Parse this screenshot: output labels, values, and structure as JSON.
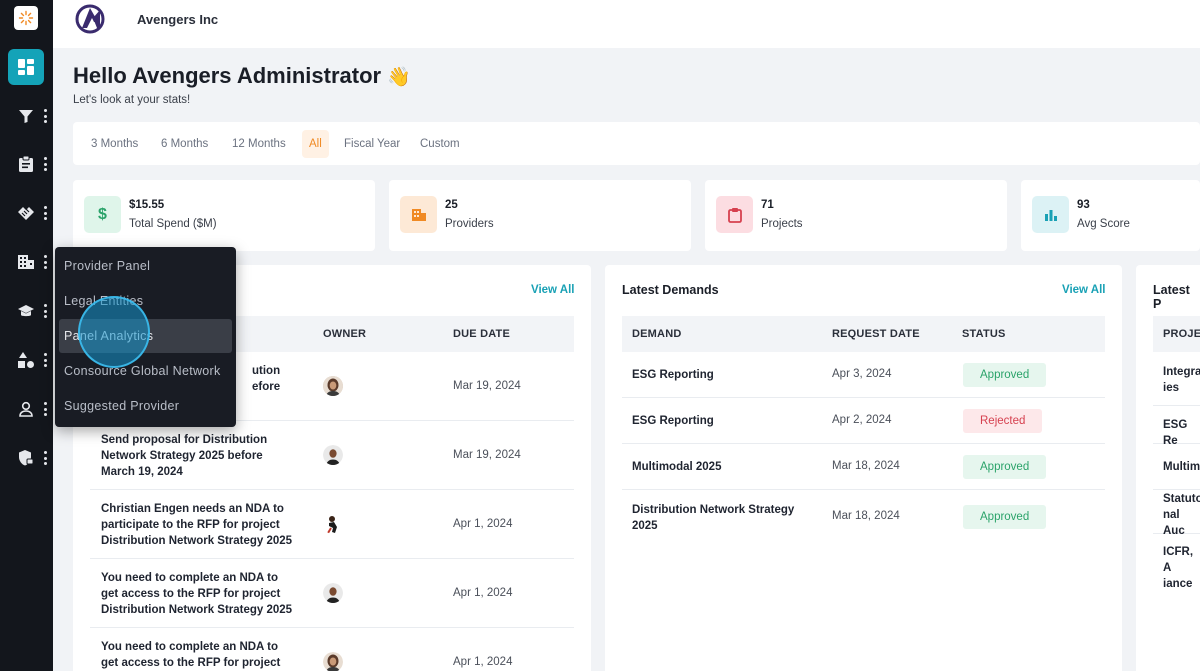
{
  "brand": {
    "name": "Avengers Inc"
  },
  "greeting": {
    "title": "Hello Avengers Administrator",
    "emoji": "👋",
    "subtitle": "Let's look at your stats!"
  },
  "periods": [
    {
      "label": "3 Months",
      "active": false
    },
    {
      "label": "6 Months",
      "active": false
    },
    {
      "label": "12 Months",
      "active": false
    },
    {
      "label": "All",
      "active": true
    },
    {
      "label": "Fiscal Year",
      "active": false
    },
    {
      "label": "Custom",
      "active": false
    }
  ],
  "stats": [
    {
      "value": "$15.55",
      "label": "Total Spend ($M)",
      "icon": "dollar-icon",
      "color": "#2ba36a",
      "bg": "#dff5ea"
    },
    {
      "value": "25",
      "label": "Providers",
      "icon": "building-icon",
      "color": "#f08a24",
      "bg": "#fde9d6"
    },
    {
      "value": "71",
      "label": "Projects",
      "icon": "clipboard-icon",
      "color": "#d6404f",
      "bg": "#fcdde2"
    },
    {
      "value": "93",
      "label": "Avg Score",
      "icon": "bar-chart-icon",
      "color": "#19a1b5",
      "bg": "#dcf2f5"
    }
  ],
  "tasks": {
    "view_all": "View All",
    "columns": [
      "OWNER",
      "DUE DATE"
    ],
    "rows": [
      {
        "lines": [
          "ution",
          "efore"
        ],
        "date": "Mar 19, 2024",
        "avatar": "female"
      },
      {
        "lines": [
          "Send proposal for Distribution",
          "Network Strategy 2025 before",
          "March 19, 2024"
        ],
        "date": "Mar 19, 2024",
        "avatar": "male"
      },
      {
        "lines": [
          "Christian Engen needs an NDA to",
          "participate to the RFP for project",
          "Distribution Network Strategy 2025"
        ],
        "date": "Apr 1, 2024",
        "avatar": "runner"
      },
      {
        "lines": [
          "You need to complete an NDA to",
          "get access to the RFP for project",
          "Distribution Network Strategy 2025"
        ],
        "date": "Apr 1, 2024",
        "avatar": "male"
      },
      {
        "lines": [
          "You need to complete an NDA to",
          "get access to the RFP for project"
        ],
        "date": "Apr 1, 2024",
        "avatar": "female"
      }
    ]
  },
  "demands": {
    "title": "Latest Demands",
    "view_all": "View All",
    "columns": [
      "DEMAND",
      "REQUEST DATE",
      "STATUS"
    ],
    "rows": [
      {
        "lines": [
          "ESG Reporting"
        ],
        "date": "Apr 3, 2024",
        "status": "Approved"
      },
      {
        "lines": [
          "ESG Reporting"
        ],
        "date": "Apr 2, 2024",
        "status": "Rejected"
      },
      {
        "lines": [
          "Multimodal 2025"
        ],
        "date": "Mar 18, 2024",
        "status": "Approved"
      },
      {
        "lines": [
          "Distribution Network Strategy",
          "2025"
        ],
        "date": "Mar 18, 2024",
        "status": "Approved"
      }
    ]
  },
  "projects": {
    "title": "Latest P",
    "column": "PROJEC",
    "rows": [
      {
        "lines": [
          "Integra",
          "ies"
        ]
      },
      {
        "lines": [
          "ESG Re"
        ]
      },
      {
        "lines": [
          "Multim"
        ]
      },
      {
        "lines": [
          "Statuto",
          "nal Auc"
        ]
      },
      {
        "lines": [
          "ICFR, A",
          "iance"
        ]
      }
    ]
  },
  "menu": {
    "items": [
      {
        "label": "Provider Panel"
      },
      {
        "label": "Legal Entities"
      },
      {
        "label": "Panel Analytics"
      },
      {
        "label": "Consource Global Network"
      },
      {
        "label": "Suggested Provider"
      }
    ]
  },
  "sidebar": {
    "icons": [
      "dashboard-icon",
      "filter-icon",
      "clipboard-icon",
      "handshake-icon",
      "building-icon",
      "graduation-cap-icon",
      "shapes-icon",
      "user-icon",
      "shield-lock-icon"
    ]
  },
  "colors": {
    "accent": "#14a3b8",
    "orange": "#f08a24",
    "sidebar": "#13161c"
  }
}
